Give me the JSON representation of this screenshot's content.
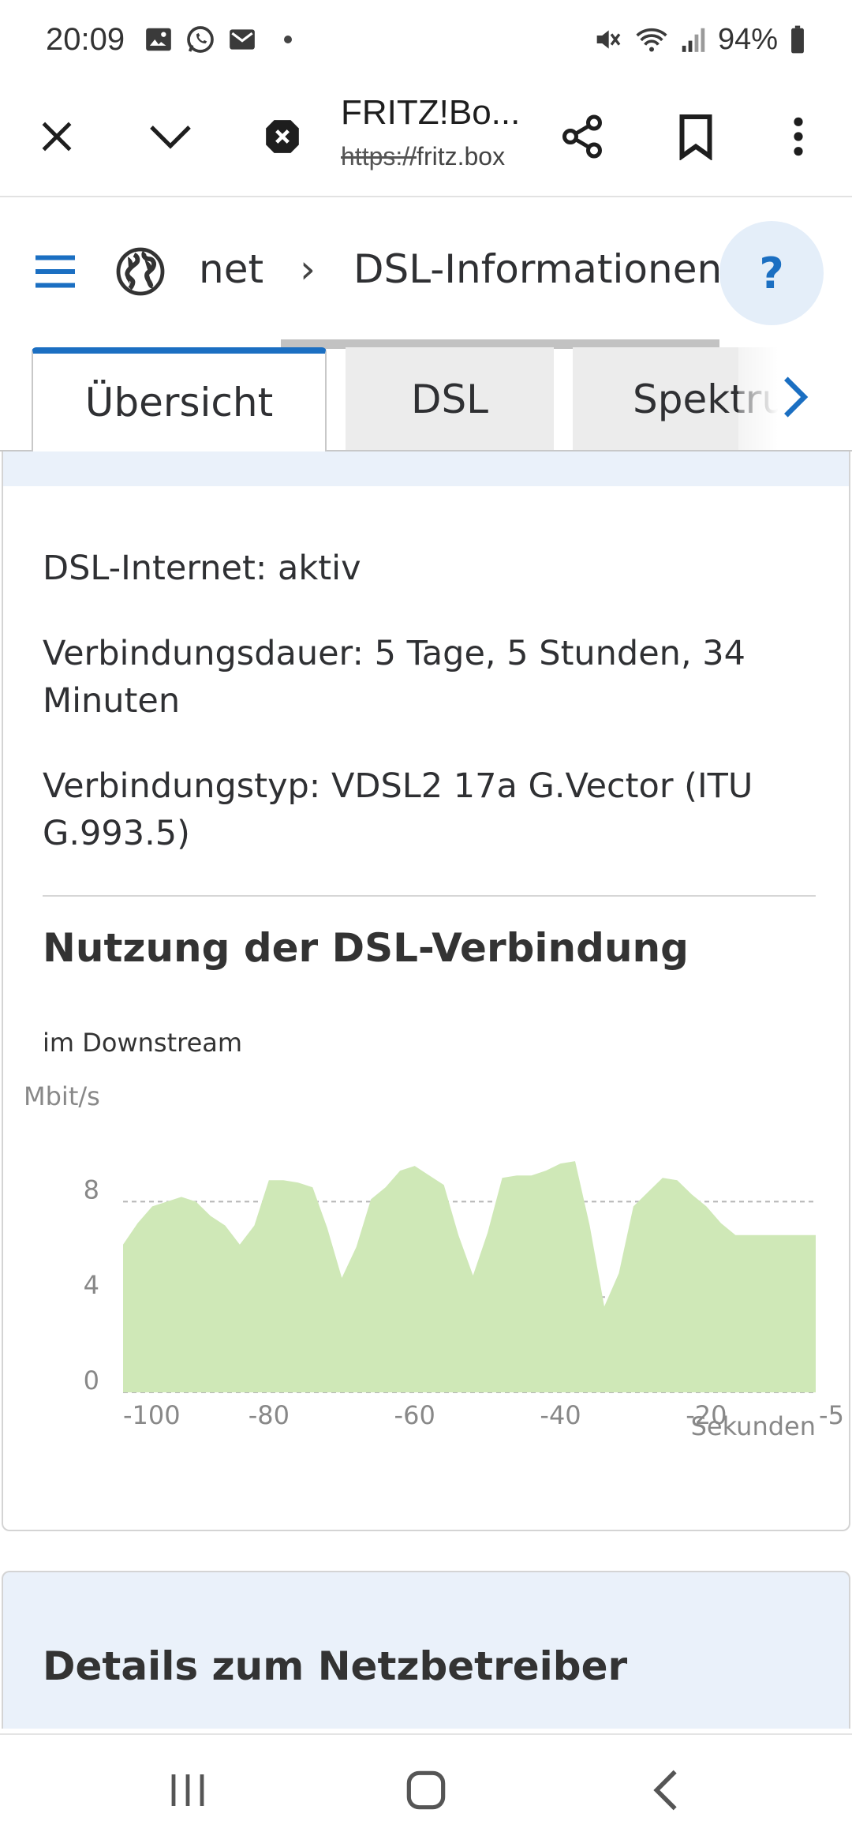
{
  "status_bar": {
    "time": "20:09",
    "battery": "94%",
    "left_icons": [
      "gallery-icon",
      "whatsapp-icon",
      "mail-icon"
    ],
    "right_icons": [
      "mute-icon",
      "wifi-icon",
      "signal-icon",
      "battery-icon"
    ]
  },
  "browser": {
    "title": "FRITZ!Bo...",
    "url_scheme": "https://",
    "url_host": "fritz.box"
  },
  "breadcrumb": {
    "parent": "net",
    "separator": "›",
    "current": "DSL-Informationen",
    "help_label": "?"
  },
  "tabs": [
    {
      "label": "Übersicht",
      "active": true
    },
    {
      "label": "DSL",
      "active": false
    },
    {
      "label": "Spektrum",
      "active": false
    }
  ],
  "overview": {
    "dsl_internet": "DSL-Internet: aktiv",
    "connection_duration": "Verbindungsdauer: 5 Tage, 5 Stunden, 34 Minuten",
    "connection_type": "Verbindungstyp: VDSL2 17a G.Vector (ITU G.993.5)"
  },
  "usage": {
    "title": "Nutzung der DSL-Verbindung",
    "subtitle": "im Downstream"
  },
  "chart_data": {
    "type": "area",
    "title": "",
    "xlabel": "Sekunden",
    "ylabel": "Mbit/s",
    "xlim": [
      -100,
      -5
    ],
    "ylim": [
      0,
      10
    ],
    "x_ticks": [
      "-100",
      "-80",
      "-60",
      "-40",
      "-20",
      "-5"
    ],
    "y_ticks": [
      "0",
      "4",
      "8"
    ],
    "grid": true,
    "fill_color": "#cfe8b7",
    "series": [
      {
        "x": [
          -100,
          -98,
          -96,
          -94,
          -92,
          -90,
          -88,
          -86,
          -84,
          -82,
          -80,
          -78,
          -76,
          -74,
          -72,
          -70,
          -68,
          -66,
          -64,
          -62,
          -60,
          -58,
          -56,
          -54,
          -52,
          -50,
          -48,
          -46,
          -44,
          -42,
          -40,
          -38,
          -36,
          -34,
          -32,
          -30,
          -28,
          -26,
          -24,
          -22,
          -20,
          -18,
          -16,
          -14,
          -12,
          -10,
          -8,
          -6,
          -5
        ],
        "values": [
          6.2,
          7.1,
          7.8,
          8.0,
          8.2,
          8.0,
          7.4,
          7.0,
          6.2,
          7.0,
          8.9,
          8.9,
          8.8,
          8.6,
          6.9,
          4.8,
          6.1,
          8.1,
          8.6,
          9.3,
          9.5,
          9.1,
          8.7,
          6.6,
          4.9,
          6.7,
          9.0,
          9.1,
          9.1,
          9.3,
          9.6,
          9.7,
          7.0,
          3.6,
          5.0,
          7.8,
          8.4,
          9.0,
          8.9,
          8.3,
          7.8,
          7.1,
          6.6,
          6.6,
          6.6,
          6.6,
          6.6,
          6.6,
          6.6
        ]
      }
    ]
  },
  "provider": {
    "title": "Details zum Netzbetreiber"
  },
  "nav": {
    "recent": "recent-apps-icon",
    "home": "home-icon",
    "back": "back-icon"
  }
}
